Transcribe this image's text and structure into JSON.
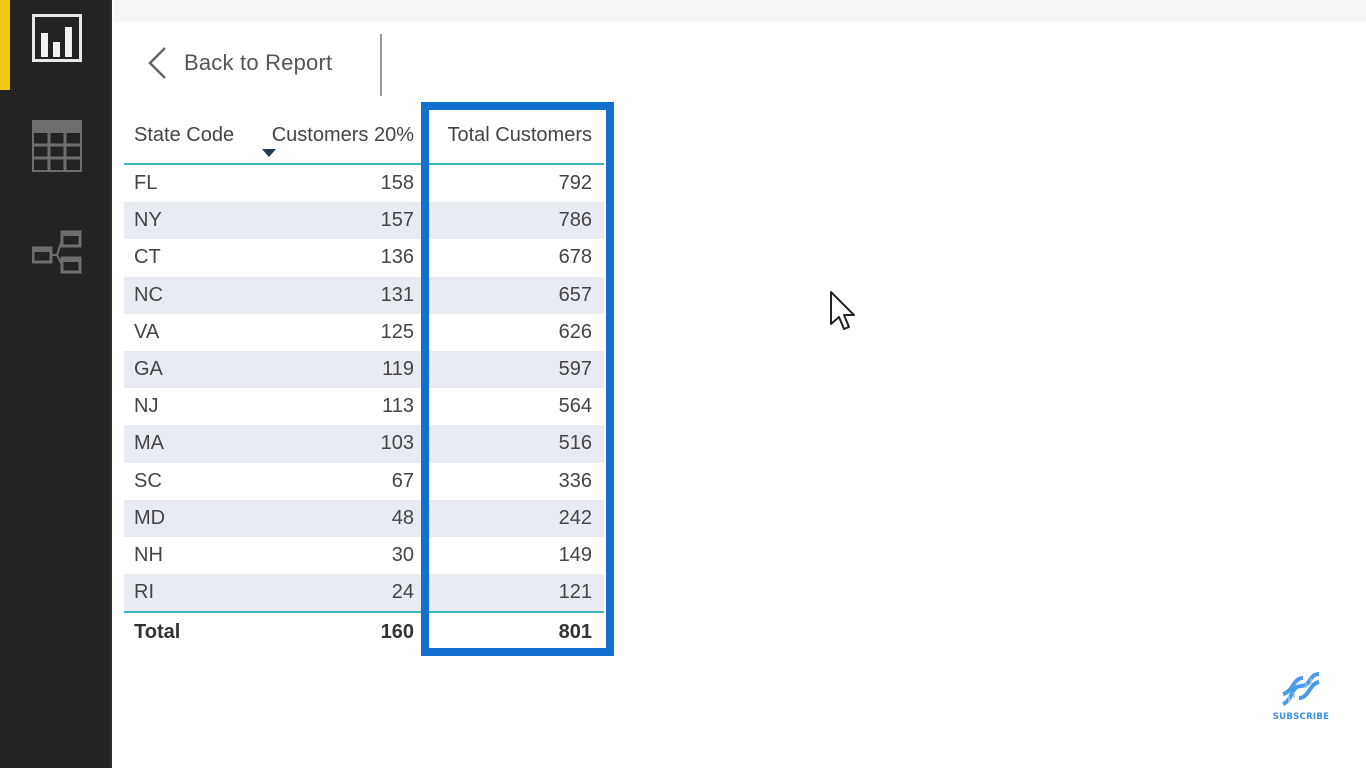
{
  "sidebar": {
    "items": [
      {
        "name": "report-view",
        "icon": "bar-chart-icon",
        "active": true
      },
      {
        "name": "data-view",
        "icon": "table-grid-icon",
        "active": false
      },
      {
        "name": "model-view",
        "icon": "relationship-diagram-icon",
        "active": false
      }
    ],
    "accent_color": "#f2c811"
  },
  "header": {
    "back_label": "Back to Report",
    "back_icon": "chevron-left-icon"
  },
  "table": {
    "columns": [
      "State Code",
      "Customers 20%",
      "Total Customers"
    ],
    "sorted_column": "Customers 20%",
    "sort_direction": "descending",
    "rows": [
      {
        "state": "FL",
        "customers_20": "158",
        "total": "792"
      },
      {
        "state": "NY",
        "customers_20": "157",
        "total": "786"
      },
      {
        "state": "CT",
        "customers_20": "136",
        "total": "678"
      },
      {
        "state": "NC",
        "customers_20": "131",
        "total": "657"
      },
      {
        "state": "VA",
        "customers_20": "125",
        "total": "626"
      },
      {
        "state": "GA",
        "customers_20": "119",
        "total": "597"
      },
      {
        "state": "NJ",
        "customers_20": "113",
        "total": "564"
      },
      {
        "state": "MA",
        "customers_20": "103",
        "total": "516"
      },
      {
        "state": "SC",
        "customers_20": "67",
        "total": "336"
      },
      {
        "state": "MD",
        "customers_20": "48",
        "total": "242"
      },
      {
        "state": "NH",
        "customers_20": "30",
        "total": "149"
      },
      {
        "state": "RI",
        "customers_20": "24",
        "total": "121"
      }
    ],
    "totals": {
      "label": "Total",
      "customers_20": "160",
      "total": "801"
    },
    "highlighted_column": "Total Customers",
    "highlight_color": "#1470d0",
    "rule_color": "#38b6c4"
  },
  "watermark": {
    "label": "SUBSCRIBE",
    "icon": "dna-icon",
    "color": "#3b8fe0"
  }
}
